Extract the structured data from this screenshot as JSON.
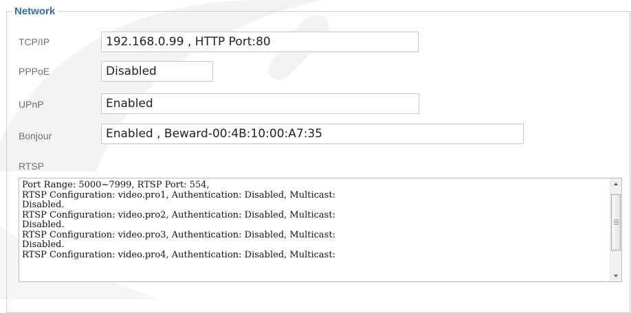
{
  "network": {
    "legend": "Network",
    "rows": [
      {
        "label": "TCP/IP",
        "value": "192.168.0.99 , HTTP Port:80"
      },
      {
        "label": "PPPoE",
        "value": "Disabled"
      },
      {
        "label": "UPnP",
        "value": "Enabled"
      },
      {
        "label": "Bonjour",
        "value": "Enabled , Beward-00:4B:10:00:A7:35"
      }
    ],
    "rtsp": {
      "label": "RTSP",
      "lines": [
        "Port Range: 5000~7999, RTSP Port: 554,",
        "RTSP Configuration: video.pro1, Authentication: Disabled, Multicast:",
        "Disabled.",
        "RTSP Configuration: video.pro2, Authentication: Disabled, Multicast:",
        "Disabled.",
        "RTSP Configuration: video.pro3, Authentication: Disabled, Multicast:",
        "Disabled.",
        "RTSP Configuration: video.pro4, Authentication: Disabled, Multicast:"
      ]
    }
  },
  "colors": {
    "legend": "#3a6ea5",
    "label": "#6f6f6f",
    "border": "#c6c6c6"
  },
  "icons": {
    "scroll_up": "scroll-up-arrow-icon",
    "scroll_down": "scroll-down-arrow-icon",
    "thumb_grip": "scroll-thumb-grip-icon"
  }
}
